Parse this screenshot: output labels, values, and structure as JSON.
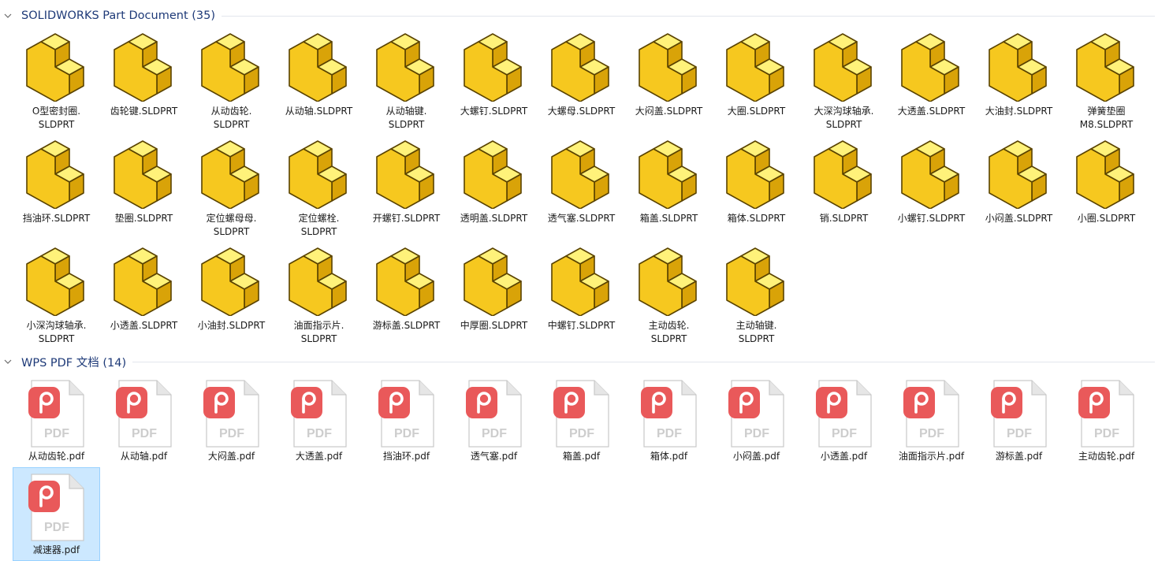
{
  "groups": [
    {
      "id": "sw",
      "title": "SOLIDWORKS Part Document (35)",
      "icon": "solidworks-part-icon",
      "items": [
        {
          "l1": "O型密封圈.",
          "l2": "SLDPRT"
        },
        {
          "l1": "齿轮键.SLDPRT",
          "l2": ""
        },
        {
          "l1": "从动齿轮.",
          "l2": "SLDPRT"
        },
        {
          "l1": "从动轴.SLDPRT",
          "l2": ""
        },
        {
          "l1": "从动轴键.",
          "l2": "SLDPRT"
        },
        {
          "l1": "大螺钉.SLDPRT",
          "l2": ""
        },
        {
          "l1": "大螺母.SLDPRT",
          "l2": ""
        },
        {
          "l1": "大闷盖.SLDPRT",
          "l2": ""
        },
        {
          "l1": "大圈.SLDPRT",
          "l2": ""
        },
        {
          "l1": "大深沟球轴承.",
          "l2": "SLDPRT"
        },
        {
          "l1": "大透盖.SLDPRT",
          "l2": ""
        },
        {
          "l1": "大油封.SLDPRT",
          "l2": ""
        },
        {
          "l1": "弹簧垫圈",
          "l2": "M8.SLDPRT"
        },
        {
          "l1": "挡油环.SLDPRT",
          "l2": ""
        },
        {
          "l1": "垫圈.SLDPRT",
          "l2": ""
        },
        {
          "l1": "定位螺母母.",
          "l2": "SLDPRT"
        },
        {
          "l1": "定位螺栓.",
          "l2": "SLDPRT"
        },
        {
          "l1": "开螺钉.SLDPRT",
          "l2": ""
        },
        {
          "l1": "透明盖.SLDPRT",
          "l2": ""
        },
        {
          "l1": "透气塞.SLDPRT",
          "l2": ""
        },
        {
          "l1": "箱盖.SLDPRT",
          "l2": ""
        },
        {
          "l1": "箱体.SLDPRT",
          "l2": ""
        },
        {
          "l1": "销.SLDPRT",
          "l2": ""
        },
        {
          "l1": "小螺钉.SLDPRT",
          "l2": ""
        },
        {
          "l1": "小闷盖.SLDPRT",
          "l2": ""
        },
        {
          "l1": "小圈.SLDPRT",
          "l2": ""
        },
        {
          "l1": "小深沟球轴承.",
          "l2": "SLDPRT"
        },
        {
          "l1": "小透盖.SLDPRT",
          "l2": ""
        },
        {
          "l1": "小油封.SLDPRT",
          "l2": ""
        },
        {
          "l1": "油面指示片.",
          "l2": "SLDPRT"
        },
        {
          "l1": "游标盖.SLDPRT",
          "l2": ""
        },
        {
          "l1": "中厚圈.SLDPRT",
          "l2": ""
        },
        {
          "l1": "中螺钉.SLDPRT",
          "l2": ""
        },
        {
          "l1": "主动齿轮.",
          "l2": "SLDPRT"
        },
        {
          "l1": "主动轴键.",
          "l2": "SLDPRT"
        }
      ]
    },
    {
      "id": "pdf",
      "title": "WPS PDF 文档 (14)",
      "icon": "wps-pdf-icon",
      "icon_text": "PDF",
      "items": [
        {
          "l1": "从动齿轮.pdf",
          "l2": ""
        },
        {
          "l1": "从动轴.pdf",
          "l2": ""
        },
        {
          "l1": "大闷盖.pdf",
          "l2": ""
        },
        {
          "l1": "大透盖.pdf",
          "l2": ""
        },
        {
          "l1": "挡油环.pdf",
          "l2": ""
        },
        {
          "l1": "透气塞.pdf",
          "l2": ""
        },
        {
          "l1": "箱盖.pdf",
          "l2": ""
        },
        {
          "l1": "箱体.pdf",
          "l2": ""
        },
        {
          "l1": "小闷盖.pdf",
          "l2": ""
        },
        {
          "l1": "小透盖.pdf",
          "l2": ""
        },
        {
          "l1": "油面指示片.pdf",
          "l2": ""
        },
        {
          "l1": "游标盖.pdf",
          "l2": ""
        },
        {
          "l1": "主动齿轮.pdf",
          "l2": ""
        },
        {
          "l1": "减速器.pdf",
          "l2": "",
          "selected": true
        }
      ]
    }
  ],
  "colors": {
    "header_text": "#1e3a78",
    "selection_bg": "#cce8ff",
    "selection_border": "#99d1ff",
    "part_top": "#fff27a",
    "part_front": "#f6c81f",
    "part_side": "#d9a308",
    "part_outline": "#5a4300",
    "pdf_badge": "#e9595a",
    "pdf_text": "#cdcdcd"
  }
}
